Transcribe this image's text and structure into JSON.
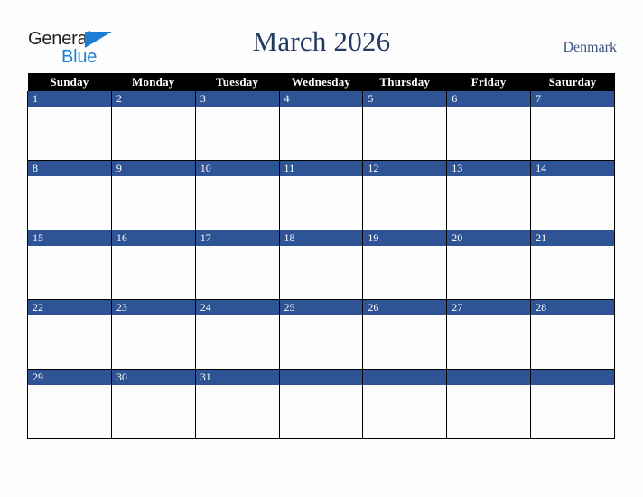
{
  "brand": {
    "name_part1": "General",
    "name_part2": "Blue",
    "triangle_color": "#1b7fd4",
    "text_color": "#231f20"
  },
  "header": {
    "title": "March 2026",
    "country": "Denmark",
    "title_color": "#233a63",
    "country_color": "#3c5280"
  },
  "calendar": {
    "month": "March",
    "year": "2026",
    "header_bg": "#000000",
    "daynum_bg": "#2f5496",
    "cell_bg": "#fdfdfd",
    "weekday_headers": [
      "Sunday",
      "Monday",
      "Tuesday",
      "Wednesday",
      "Thursday",
      "Friday",
      "Saturday"
    ],
    "weeks": [
      {
        "days": [
          {
            "num": "1"
          },
          {
            "num": "2"
          },
          {
            "num": "3"
          },
          {
            "num": "4"
          },
          {
            "num": "5"
          },
          {
            "num": "6"
          },
          {
            "num": "7"
          }
        ]
      },
      {
        "days": [
          {
            "num": "8"
          },
          {
            "num": "9"
          },
          {
            "num": "10"
          },
          {
            "num": "11"
          },
          {
            "num": "12"
          },
          {
            "num": "13"
          },
          {
            "num": "14"
          }
        ]
      },
      {
        "days": [
          {
            "num": "15"
          },
          {
            "num": "16"
          },
          {
            "num": "17"
          },
          {
            "num": "18"
          },
          {
            "num": "19"
          },
          {
            "num": "20"
          },
          {
            "num": "21"
          }
        ]
      },
      {
        "days": [
          {
            "num": "22"
          },
          {
            "num": "23"
          },
          {
            "num": "24"
          },
          {
            "num": "25"
          },
          {
            "num": "26"
          },
          {
            "num": "27"
          },
          {
            "num": "28"
          }
        ]
      },
      {
        "days": [
          {
            "num": "29"
          },
          {
            "num": "30"
          },
          {
            "num": "31"
          },
          {
            "num": ""
          },
          {
            "num": ""
          },
          {
            "num": ""
          },
          {
            "num": ""
          }
        ]
      }
    ]
  }
}
